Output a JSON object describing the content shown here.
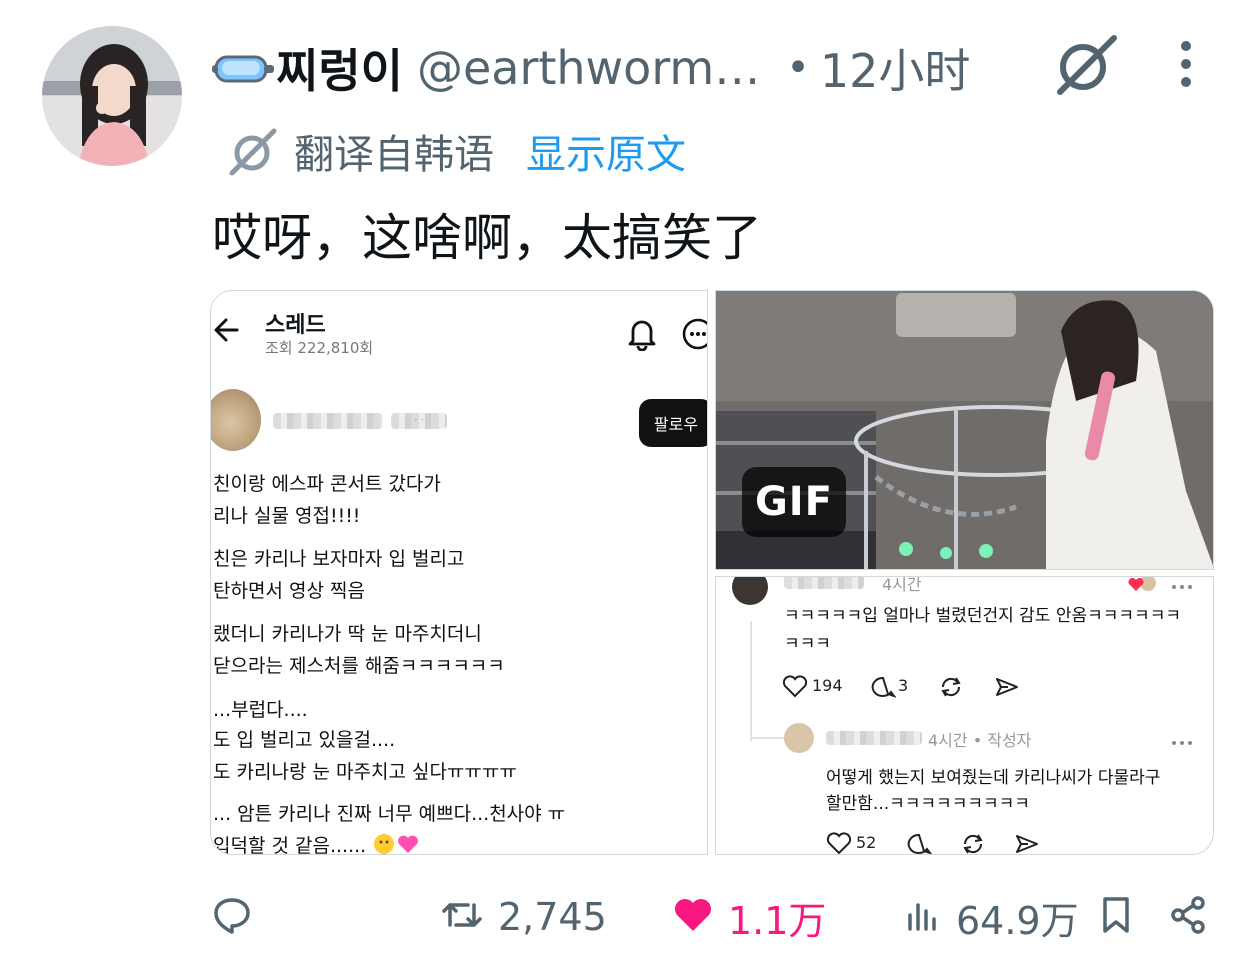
{
  "tweet": {
    "display_name": "찌렁이",
    "handle": "@earthworm…",
    "separator": "•",
    "time": "12小时",
    "translate_label": "翻译自韩语",
    "show_original": "显示原文",
    "text": "哎呀，这啥啊，太搞笑了"
  },
  "media_left": {
    "title": "스레드",
    "views": "조회 222,810회",
    "follow": "팔로우",
    "redacted_tail": "· ·",
    "lines": [
      "친이랑 에스파 콘서트 갔다가",
      "리나 실물 영접!!!!",
      "친은 카리나 보자마자 입 벌리고",
      "탄하면서 영상 찍음",
      "랬더니 카리나가 딱 눈 마주치더니",
      " 닫으라는 제스처를 해줌ㅋㅋㅋㅋㅋㅋ",
      "...부럽다....",
      "도 입 벌리고 있을걸....",
      "도 카리나랑 눈 마주치고 싶다ㅠㅠㅠㅠ",
      "... 암튼 카리나 진짜 너무 예쁘다...천사야 ㅠ",
      "입덕할 것 같음......"
    ]
  },
  "media_right_top": {
    "badge": "GIF"
  },
  "media_right_bottom": {
    "comment1_time": "4시간",
    "comment1_line1": "ㅋㅋㅋㅋㅋ입 얼마나 벌렸던건지 감도 안옴ㅋㅋㅋㅋㅋㅋ",
    "comment1_line2": "ㅋㅋㅋ",
    "comment1_likes": "194",
    "comment1_replies": "3",
    "reply_meta": "4시간 • 작성자",
    "reply_line1": "어떻게 했는지 보여줬는데 카리나씨가 다물라구",
    "reply_line2": "할만함...ㅋㅋㅋㅋㅋㅋㅋㅋㅋ",
    "reply_likes": "52"
  },
  "actions": {
    "retweets": "2,745",
    "likes": "1.1万",
    "views": "64.9万"
  },
  "colors": {
    "text": "#0f1419",
    "secondary": "#536471",
    "link": "#1d9bf0",
    "like": "#f91880",
    "border": "#cfd9de"
  },
  "icons": [
    "goggles-emoji-icon",
    "grok-icon",
    "more-vertical-icon",
    "translate-icon",
    "reply-icon",
    "retweet-icon",
    "like-heart-icon",
    "views-chart-icon",
    "bookmark-icon",
    "share-icon"
  ]
}
